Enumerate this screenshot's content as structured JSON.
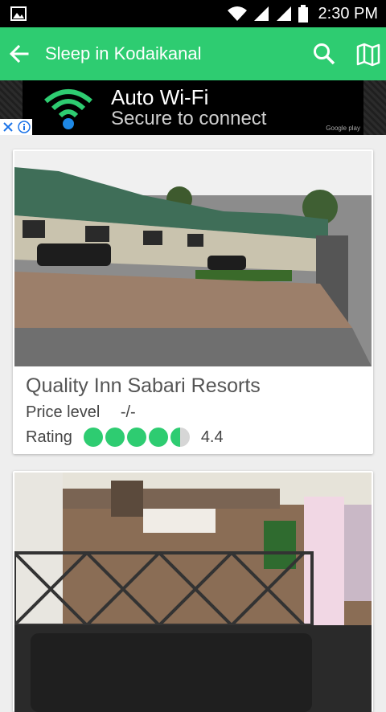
{
  "status_bar": {
    "time": "2:30 PM"
  },
  "app_bar": {
    "title": "Sleep in Kodaikanal",
    "back_icon": "arrow-left-icon",
    "search_icon": "search-icon",
    "map_icon": "map-icon"
  },
  "ad": {
    "title": "Auto Wi-Fi",
    "subtitle": "Secure to connect",
    "store": "Google play"
  },
  "hotels": [
    {
      "name": "Quality Inn Sabari Resorts",
      "price_label": "Price level",
      "price_value": "-/-",
      "rating_label": "Rating",
      "rating_value": "4.4",
      "rating_fraction": 0.88
    }
  ],
  "colors": {
    "accent": "#2ecc71",
    "statusbar": "#000000"
  }
}
